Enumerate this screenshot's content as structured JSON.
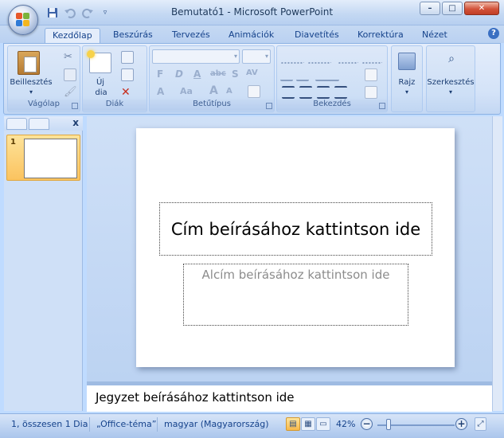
{
  "window": {
    "title": "Bemutató1 - Microsoft PowerPoint",
    "minimize": "–",
    "maximize": "□",
    "close": "✕"
  },
  "quick_access": {
    "save_icon": "floppy-disk-icon",
    "undo_icon": "undo-icon",
    "redo_icon": "redo-icon",
    "customize_icon": "dropdown-arrow-icon"
  },
  "tabs": [
    "Kezdőlap",
    "Beszúrás",
    "Tervezés",
    "Animációk",
    "Diavetítés",
    "Korrektúra",
    "Nézet"
  ],
  "active_tab": "Kezdőlap",
  "ribbon": {
    "clipboard": {
      "label": "Vágólap",
      "paste": "Beillesztés"
    },
    "slides": {
      "label": "Diák",
      "new_slide_1": "Új",
      "new_slide_2": "dia"
    },
    "font": {
      "label": "Betűtípus",
      "bold": "F",
      "italic": "D",
      "underline": "A",
      "strike": "abc",
      "shadow": "S",
      "spacing": "AV",
      "grow": "A",
      "shrink": "A",
      "color": "A",
      "size_up": "Aa"
    },
    "paragraph": {
      "label": "Bekezdés"
    },
    "drawing": {
      "label": "Rajz"
    },
    "editing": {
      "label": "Szerkesztés"
    }
  },
  "slide_pane": {
    "slide_number": "1",
    "close": "x"
  },
  "slide": {
    "title_placeholder": "Cím beírásához kattintson ide",
    "subtitle_placeholder": "Alcím beírásához kattintson ide"
  },
  "notes": {
    "placeholder": "Jegyzet beírásához kattintson ide"
  },
  "statusbar": {
    "slide_info": "1, összesen 1 Dia",
    "theme": "„Office-téma”",
    "language": "magyar (Magyarország)",
    "zoom_level": "42%",
    "zoom_out": "−",
    "zoom_in": "+"
  },
  "colors": {
    "accent": "#15428b",
    "ribbon_bg": "#dbe7f9",
    "selection": "#fbc35f"
  }
}
